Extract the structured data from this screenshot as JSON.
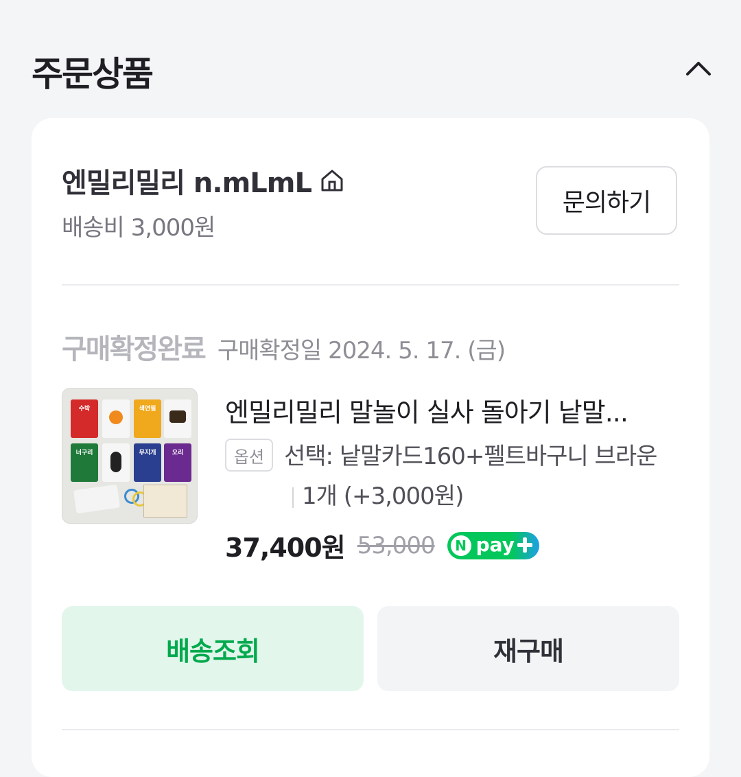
{
  "section": {
    "title": "주문상품"
  },
  "seller": {
    "name": "엔밀리밀리 n.mLmL",
    "shipping_fee": "배송비 3,000원",
    "inquiry_label": "문의하기"
  },
  "order": {
    "status": "구매확정완료",
    "confirm_date": "구매확정일 2024. 5. 17. (금)",
    "product_name": "엔밀리밀리 말놀이 실사 돌아기 낱말...",
    "option_badge": "옵션",
    "option_text": "선택: 낱말카드160+펠트바구니 브라운",
    "quantity": "1개 (+3,000원)",
    "price": "37,400원",
    "original_price": "53,000",
    "npay_label": "pay"
  },
  "thumbnail_cards": [
    "수박",
    "색연필",
    "너구리",
    "무지개",
    "오리"
  ],
  "actions": {
    "track_label": "배송조회",
    "rebuy_label": "재구매"
  },
  "colors": {
    "accent_green": "#03c75a",
    "track_bg": "#e2f6ec",
    "status_gray": "#b5b6bc"
  }
}
